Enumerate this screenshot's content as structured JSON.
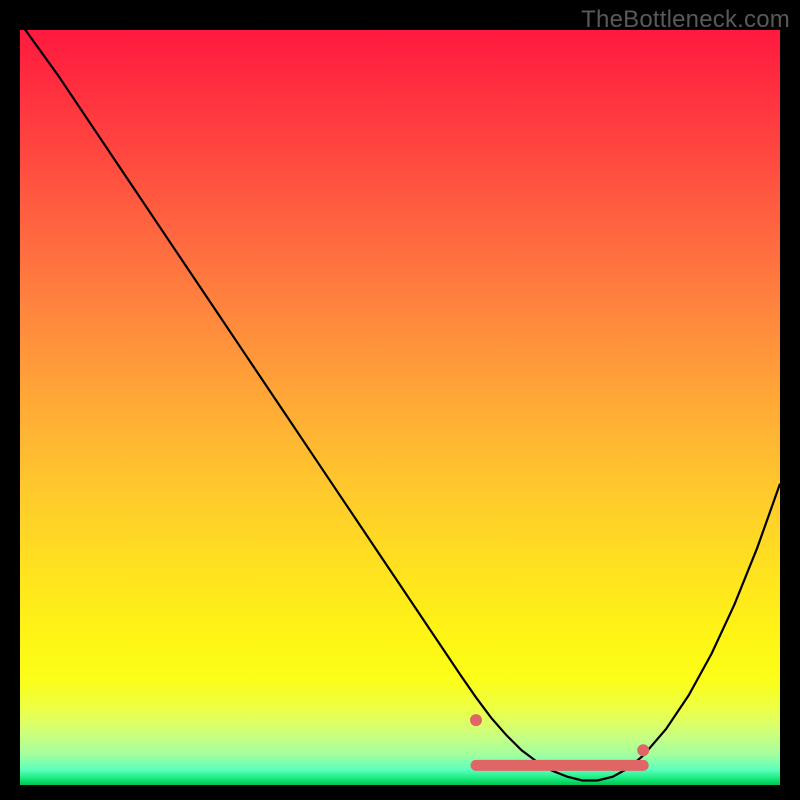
{
  "watermark": "TheBottleneck.com",
  "colors": {
    "background": "#000000",
    "curve": "#000000",
    "zone": "#e06666",
    "watermark": "#595959",
    "gradient_top": "#ff193f",
    "gradient_bottom": "#00c54e"
  },
  "chart_data": {
    "type": "line",
    "title": "",
    "xlabel": "",
    "ylabel": "",
    "xlim": [
      0,
      100
    ],
    "ylim": [
      0,
      100
    ],
    "series": [
      {
        "name": "bottleneck-curve",
        "x": [
          0,
          5,
          10,
          15,
          20,
          25,
          30,
          35,
          40,
          45,
          50,
          55,
          58,
          60,
          62,
          64,
          66,
          68,
          70,
          72,
          74,
          76,
          78,
          80,
          82,
          85,
          88,
          91,
          94,
          97,
          100
        ],
        "y": [
          101,
          94,
          86.5,
          79,
          71.5,
          64,
          56.5,
          49,
          41.5,
          34,
          26.5,
          19,
          14.5,
          11.6,
          8.9,
          6.6,
          4.6,
          3.1,
          1.9,
          1.1,
          0.6,
          0.6,
          1.1,
          2.2,
          3.9,
          7.4,
          11.9,
          17.4,
          23.9,
          31.4,
          39.9
        ]
      }
    ],
    "optimal_zone": {
      "x_start": 60,
      "x_end": 82,
      "y": 2.6
    }
  }
}
